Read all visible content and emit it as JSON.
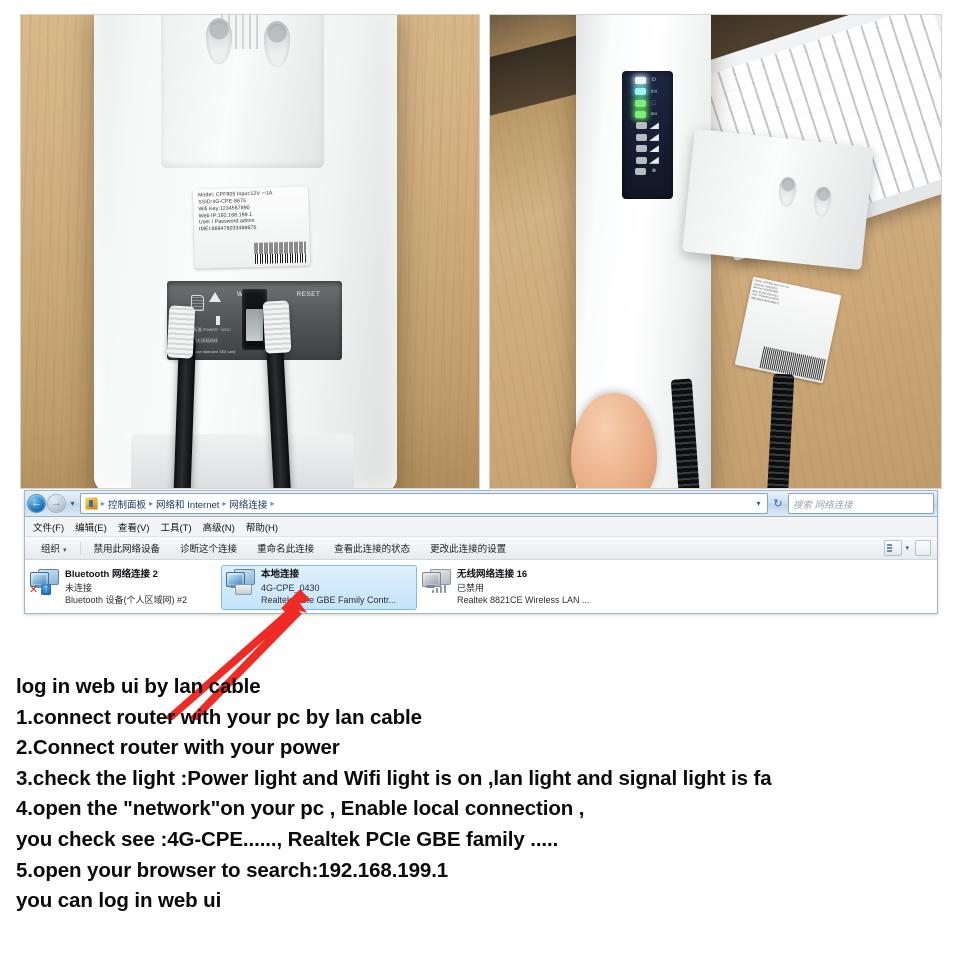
{
  "photos": {
    "left": {
      "name": "router-back-with-mount-bracket-photo",
      "device_label": {
        "lines": [
          "Model: CPF905      Input:12V ⎓1A",
          "SSID:4G-CPE-8675",
          "Wifi Key:1234567890",
          "Web IP:192.168.199.1",
          "User / Password:admin",
          "IMEI:869478033488675"
        ]
      },
      "port_labels": {
        "wan": "WAN",
        "reset": "RESET"
      },
      "port_notes": [
        "1. 请使用标准 POWER（12V）",
        "2. 请先上电后再插网线",
        "1. Please use standard SIM card"
      ]
    },
    "right": {
      "name": "router-led-indicator-panel-photo",
      "led_panel": {
        "rows": [
          {
            "icon": "power-icon",
            "glyph": "⏻",
            "state": "on",
            "color": "#f4fbff"
          },
          {
            "icon": "wifi-icon",
            "glyph": "((•))",
            "state": "on",
            "color": "#9ff4ec"
          },
          {
            "icon": "lan-icon",
            "glyph": "⬚",
            "state": "on",
            "color": "#7ef07a"
          },
          {
            "icon": "signal-label-icon",
            "glyph": "SIG",
            "state": "on",
            "color": "#7ef07a"
          },
          {
            "icon": "signal-bar-icon",
            "glyph": "",
            "state": "off",
            "color": "#b8bcbe"
          },
          {
            "icon": "signal-bar-icon",
            "glyph": "",
            "state": "off",
            "color": "#b8bcbe"
          },
          {
            "icon": "signal-bar-icon",
            "glyph": "",
            "state": "off",
            "color": "#b8bcbe"
          },
          {
            "icon": "signal-bar-icon",
            "glyph": "",
            "state": "off",
            "color": "#b8bcbe"
          },
          {
            "icon": "globe-internet-icon",
            "glyph": "⊕",
            "state": "off",
            "color": "#b8bcbe"
          }
        ]
      },
      "device_label": {
        "lines": [
          "Model: CPF905   Input:12V 1A",
          "SSID:4G-CPE-8675",
          "Wifi Key:1234567890",
          "Web IP:192.168.199.1",
          "User / Password:admin",
          "IMEI:869478033488675"
        ]
      }
    }
  },
  "explorer": {
    "address_bar": {
      "back_glyph": "←",
      "forward_glyph": "→",
      "history_glyph": "▾",
      "control_panel_icon": "control-panel-icon",
      "breadcrumbs": [
        "控制面板",
        "网络和 Internet",
        "网络连接"
      ],
      "separator": "▸",
      "dropdown_glyph": "▾",
      "refresh_glyph": "↻"
    },
    "search": {
      "placeholder": "搜索 网络连接",
      "value": ""
    },
    "menu": [
      "文件(F)",
      "编辑(E)",
      "查看(V)",
      "工具(T)",
      "高级(N)",
      "帮助(H)"
    ],
    "toolbar": {
      "organize": "组织",
      "organize_caret": "▾",
      "items": [
        "禁用此网络设备",
        "诊断这个连接",
        "重命名此连接",
        "查看此连接的状态",
        "更改此连接的设置"
      ],
      "view_caret": "▾"
    },
    "connections": [
      {
        "name": "Bluetooth 网络连接 2",
        "status": "未连接",
        "device": "Bluetooth 设备(个人区域网) #2",
        "selected": false,
        "badge": "bluetooth-disconnected-badge"
      },
      {
        "name": "本地连接",
        "status": "4G-CPE_0430",
        "device": "Realtek PCIe GBE Family Contr...",
        "selected": true,
        "badge": "lan-plug-badge"
      },
      {
        "name": "无线网络连接 16",
        "status": "已禁用",
        "device": "Realtek 8821CE Wireless LAN ...",
        "selected": false,
        "badge": "wireless-signal-badge"
      }
    ]
  },
  "annotation": {
    "arrow_color": "#ee2b24",
    "arrow_name": "red-pointer-arrow"
  },
  "instructions": {
    "lines": [
      "log in web ui by lan cable",
      "1.connect router with your pc by lan cable",
      "2.Connect router with your power",
      "3.check the light :Power light and Wifi light is on ,lan light and signal light is fa",
      "4.open the \"network\"on your pc ,  Enable local connection ,",
      "you check see :4G-CPE......, Realtek PCIe GBE family .....",
      "5.open your browser to search:192.168.199.1",
      "you can log in web ui"
    ]
  }
}
